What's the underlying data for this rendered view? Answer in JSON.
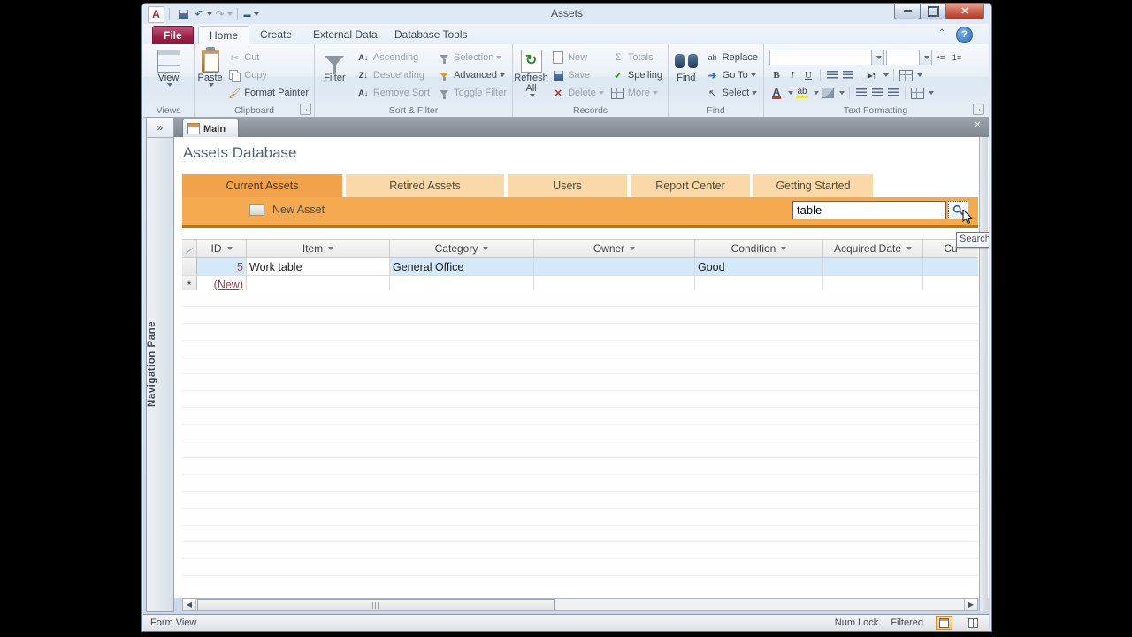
{
  "titlebar": {
    "title": "Assets"
  },
  "icons": {
    "app": "A",
    "undo": "↶",
    "redo": "↷",
    "qat_dash": "▬",
    "close": "✕",
    "collapse_ribbon": "⌃",
    "help": "?",
    "scissors": "✂",
    "sigma": "Σ",
    "check": "✔",
    "refresh": "↻",
    "nav_chevrons": "»",
    "doc_close": "✕",
    "sort_a": "A↓",
    "sort_z": "Z↓",
    "sort_az": "A↓",
    "goto_arrow": "➔",
    "select_cursor": "↖",
    "direction": "▶¶",
    "bullet": "•≡",
    "number": "1≡",
    "scroll_left": "◀",
    "scroll_right": "▶",
    "new_row_marker": "*"
  },
  "ribbon": {
    "file_tab": "File",
    "tabs": [
      "Home",
      "Create",
      "External Data",
      "Database Tools"
    ],
    "views": {
      "button": "View",
      "label": "Views"
    },
    "clipboard": {
      "paste": "Paste",
      "cut": "Cut",
      "copy": "Copy",
      "format_painter": "Format Painter",
      "label": "Clipboard"
    },
    "sort_filter": {
      "filter": "Filter",
      "ascending": "Ascending",
      "descending": "Descending",
      "remove_sort": "Remove Sort",
      "selection": "Selection",
      "advanced": "Advanced",
      "toggle_filter": "Toggle Filter",
      "label": "Sort & Filter"
    },
    "records": {
      "refresh_all": "Refresh All",
      "new": "New",
      "save": "Save",
      "delete": "Delete",
      "totals": "Totals",
      "spelling": "Spelling",
      "more": "More",
      "label": "Records"
    },
    "find": {
      "find": "Find",
      "replace": "Replace",
      "goto": "Go To",
      "select": "Select",
      "label": "Find"
    },
    "text_formatting": {
      "bold": "B",
      "italic": "I",
      "underline": "U",
      "font_color": "A",
      "highlight": "ab",
      "label": "Text Formatting"
    }
  },
  "nav_pane": {
    "label": "Navigation Pane"
  },
  "document": {
    "tab_label": "Main"
  },
  "form": {
    "title": "Assets Database",
    "tabs": [
      "Current Assets",
      "Retired Assets",
      "Users",
      "Report Center",
      "Getting Started"
    ],
    "active_tab": "Current Assets",
    "new_asset_label": "New Asset",
    "search": {
      "value": "table",
      "tooltip": "Search"
    }
  },
  "grid": {
    "columns": [
      "ID",
      "Item",
      "Category",
      "Owner",
      "Condition",
      "Acquired Date",
      "Cu"
    ],
    "rows": [
      [
        "5",
        "Work table",
        "General Office",
        "",
        "Good",
        "",
        ""
      ]
    ],
    "new_row_label": "(New)"
  },
  "statusbar": {
    "view_label": "Form View",
    "num_lock": "Num Lock",
    "filtered": "Filtered"
  },
  "colors": {
    "band_orange": "#F5AA50",
    "tab_active": "#F2A24B",
    "tab_inactive": "#FAD8A7",
    "band_underline": "#C2750A",
    "row_highlight": "#D5E9FA",
    "link_red": "#9E3A38",
    "file_tab": "#9B2048",
    "title_text": "#51626E"
  }
}
